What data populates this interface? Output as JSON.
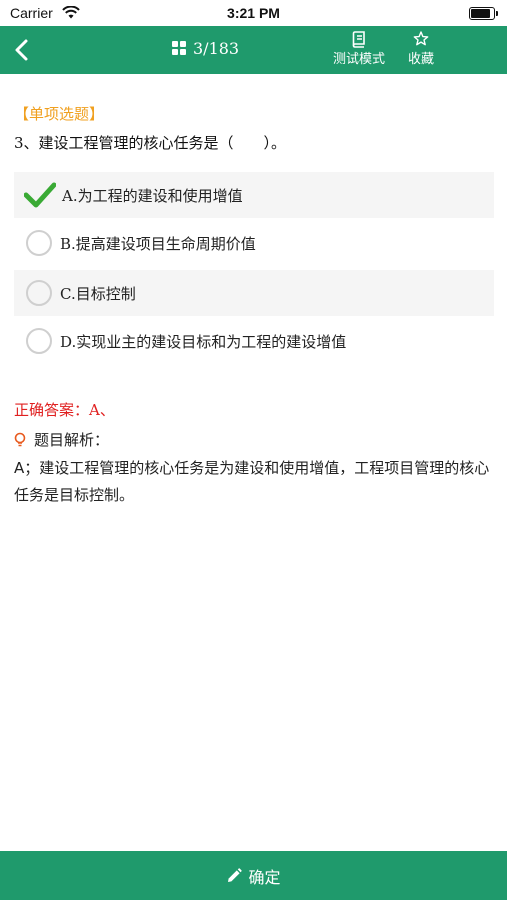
{
  "status_bar": {
    "carrier": "Carrier",
    "time": "3:21 PM",
    "battery_level": 0.95
  },
  "nav": {
    "counter": "3/183",
    "test_mode_label": "测试模式",
    "favorite_label": "收藏"
  },
  "question": {
    "type_label": "【单项选题】",
    "number": "3、",
    "text": "建设工程管理的核心任务是（　　）。",
    "options": [
      {
        "letter": "A.",
        "text": "为工程的建设和使用增值",
        "selected": true,
        "state": "correct"
      },
      {
        "letter": "B.",
        "text": "提高建设项目生命周期价值",
        "selected": false
      },
      {
        "letter": "C.",
        "text": "目标控制",
        "selected": false
      },
      {
        "letter": "D.",
        "text": "实现业主的建设目标和为工程的建设增值",
        "selected": false
      }
    ]
  },
  "answer": {
    "label": "正确答案：",
    "value": "A、"
  },
  "analysis": {
    "title": "题目解析：",
    "body": "A；建设工程管理的核心任务是为建设和使用增值，工程项目管理的核心任务是目标控制。"
  },
  "footer": {
    "confirm_label": "确定"
  },
  "colors": {
    "primary": "#1f9a6c",
    "type_label": "#f0a020",
    "answer": "#e02020",
    "check": "#3aaa35"
  },
  "icons": [
    "wifi-icon",
    "battery-icon",
    "back-icon",
    "grid-icon",
    "book-icon",
    "star-icon",
    "check-icon",
    "lightbulb-icon",
    "pencil-icon"
  ]
}
